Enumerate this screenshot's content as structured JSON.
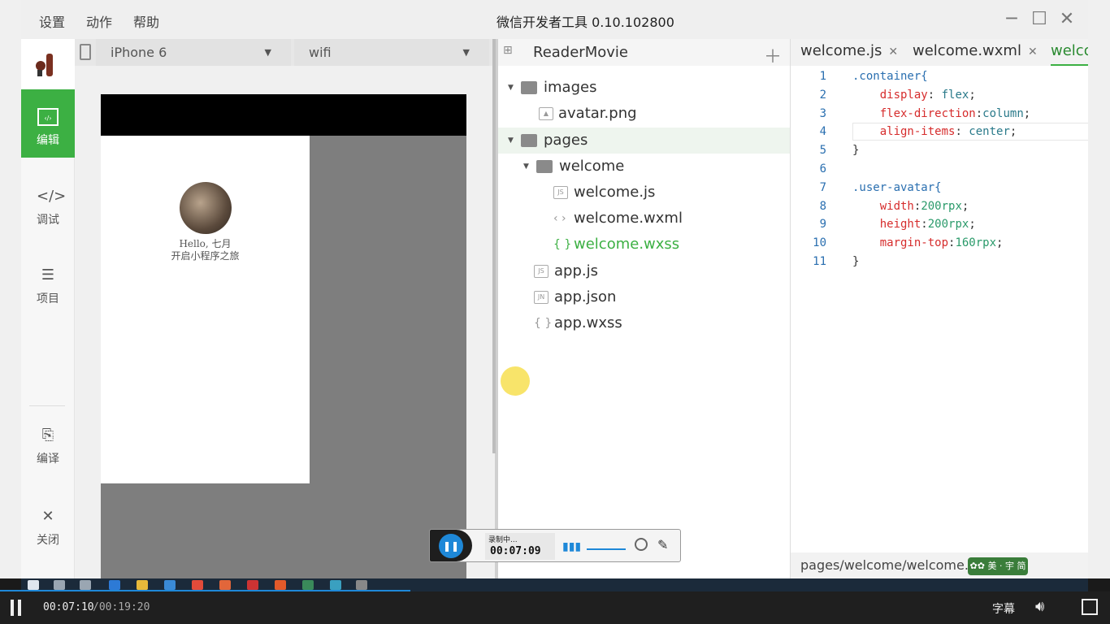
{
  "menu": {
    "settings": "设置",
    "actions": "动作",
    "help": "帮助"
  },
  "window": {
    "title": "微信开发者工具 0.10.102800"
  },
  "nav": {
    "items": [
      {
        "label": "编辑",
        "icon": "code-editor-icon"
      },
      {
        "label": "调试",
        "icon": "debug-brackets-icon"
      },
      {
        "label": "项目",
        "icon": "menu-lines-icon"
      },
      {
        "label": "编译",
        "icon": "compile-icon"
      },
      {
        "label": "关闭",
        "icon": "close-icon"
      }
    ]
  },
  "simulator": {
    "device": "iPhone 6",
    "network": "wifi",
    "greeting_line1": "Hello, 七月",
    "greeting_line2": "开启小程序之旅"
  },
  "tree": {
    "project": "ReaderMovie",
    "rows": [
      {
        "label": "images",
        "type": "folder"
      },
      {
        "label": "avatar.png",
        "type": "image"
      },
      {
        "label": "pages",
        "type": "folder"
      },
      {
        "label": "welcome",
        "type": "folder"
      },
      {
        "label": "welcome.js",
        "type": "js",
        "badge": "JS"
      },
      {
        "label": "welcome.wxml",
        "type": "wxml",
        "glyph": "‹ ›"
      },
      {
        "label": "welcome.wxss",
        "type": "wxss",
        "glyph": "{ }"
      },
      {
        "label": "app.js",
        "type": "js",
        "badge": "JS"
      },
      {
        "label": "app.json",
        "type": "json",
        "badge": "JN"
      },
      {
        "label": "app.wxss",
        "type": "wxss",
        "glyph": "{ }"
      }
    ]
  },
  "editor": {
    "tabs": [
      {
        "label": "welcome.js",
        "close": "✕"
      },
      {
        "label": "welcome.wxml",
        "close": "✕"
      },
      {
        "label": "welco"
      }
    ],
    "lines": [
      {
        "n": "1",
        "text": ".container{"
      },
      {
        "n": "2",
        "text": "    display: flex;"
      },
      {
        "n": "3",
        "text": "    flex-direction:column;"
      },
      {
        "n": "4",
        "text": "    align-items: center;"
      },
      {
        "n": "5",
        "text": "}"
      },
      {
        "n": "6",
        "text": ""
      },
      {
        "n": "7",
        "text": ".user-avatar{"
      },
      {
        "n": "8",
        "text": "    width:200rpx;"
      },
      {
        "n": "9",
        "text": "    height:200rpx;"
      },
      {
        "n": "10",
        "text": "    margin-top:160rpx;"
      },
      {
        "n": "11",
        "text": "}"
      }
    ],
    "status_path": "pages/welcome/welcome.wxss"
  },
  "recorder": {
    "status": "录制中...",
    "elapsed": "00:07:09"
  },
  "player": {
    "current": "00:07:10",
    "total": "/00:19:20",
    "subtitles": "字幕",
    "progress": 0.37
  },
  "colors": {
    "accent": "#3cb043",
    "highlight": "#1e88d8"
  }
}
